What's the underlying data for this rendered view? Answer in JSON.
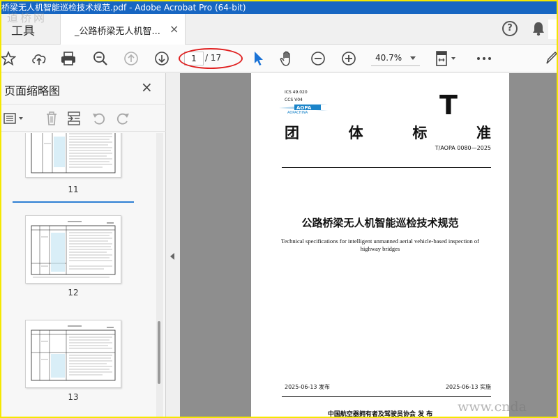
{
  "window": {
    "title": "桥梁无人机智能巡检技术规范.pdf - Adobe Acrobat Pro (64-bit)",
    "watermark": "道桥网"
  },
  "tabs": {
    "tools": "工具",
    "document": "_公路桥梁无人机智...",
    "close": "×"
  },
  "toolbar": {
    "current_page": "1",
    "total_pages": "/ 17",
    "zoom": "40.7%"
  },
  "sidebar": {
    "title": "页面缩略图",
    "close": "×",
    "thumbnails": [
      {
        "label": "11"
      },
      {
        "label": "12"
      },
      {
        "label": "13"
      }
    ]
  },
  "document": {
    "ics": "ICS  49.020",
    "ccs": "CCS  V04",
    "logo_text": "AOPACHINA",
    "big_letter": "T",
    "title_chars": [
      "团",
      "体",
      "标",
      "准"
    ],
    "standard_number": "T/AOPA 0080—2025",
    "cn_title": "公路桥梁无人机智能巡检技术规范",
    "en_title": "Technical specifications for intelligent unmanned aerial vehicle-based inspection of highway bridges",
    "issue_date": "2025-06-13  发布",
    "impl_date": "2025-06-13  实施",
    "publisher": "中国航空器拥有者及驾驶员协会  发 布",
    "site_watermark": "www.cnda"
  },
  "colors": {
    "titlebar": "#1766c2",
    "highlight": "#e02020",
    "selection": "#2d7fd3",
    "frame": "#f5e800"
  }
}
